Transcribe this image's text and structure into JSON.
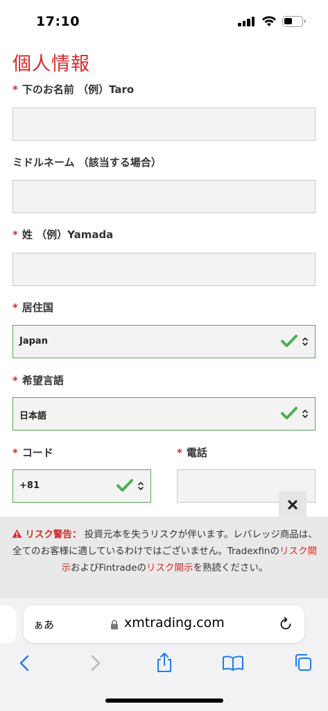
{
  "status_bar": {
    "time": "17:10"
  },
  "page": {
    "title": "個人情報"
  },
  "form": {
    "required_mark": "*",
    "first_name": {
      "label": "下のお名前 （例）Taro",
      "value": ""
    },
    "middle_name": {
      "label": "ミドルネーム （該当する場合）",
      "value": ""
    },
    "last_name": {
      "label": "姓 （例）Yamada",
      "value": ""
    },
    "country": {
      "label": "居住国",
      "value": "Japan"
    },
    "language": {
      "label": "希望言語",
      "value": "日本語"
    },
    "code": {
      "label": "コード",
      "value": "+81"
    },
    "phone": {
      "label": "電話",
      "value": ""
    }
  },
  "warning": {
    "title": "リスク警告：",
    "text1": " 投資元本を失うリスクが伴います。レバレッジ商品は、全てのお客様に適しているわけではございません。Tradexfinの",
    "link1": "リスク開示",
    "text2": "およびFintradeの",
    "link2": "リスク開示",
    "text3": "を熟読ください。"
  },
  "browser": {
    "aa_label": "ぁあ",
    "url": "xmtrading.com"
  },
  "colors": {
    "accent_red": "#d52b2b",
    "valid_green": "#4caf50",
    "ios_blue": "#1a7cf5"
  }
}
